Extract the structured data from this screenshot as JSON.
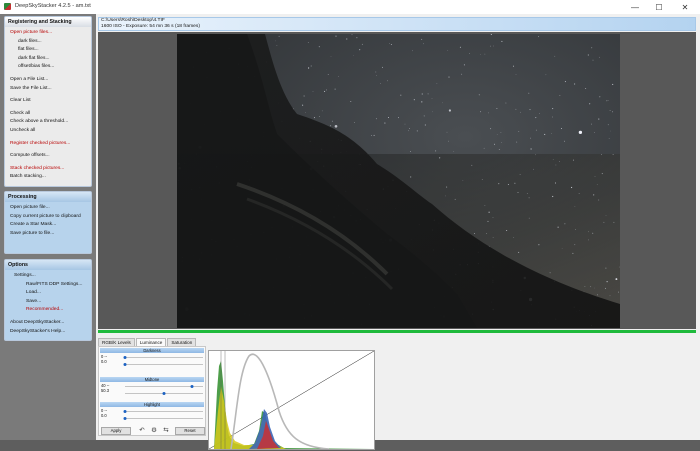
{
  "window": {
    "title": "DeepSkyStacker 4.2.5 - am.txt",
    "minimize_glyph": "—",
    "maximize_glyph": "☐",
    "close_glyph": "✕"
  },
  "panels": {
    "registering": {
      "title": "Registering and Stacking",
      "items": [
        "Open picture files...",
        "dark files...",
        "flat files...",
        "dark flat files...",
        "offset/bias files...",
        "Open a File List...",
        "Save the File List...",
        "Clear List",
        "Check all",
        "Check above a threshold...",
        "Uncheck all",
        "Register checked pictures...",
        "Compute offsets...",
        "Stack checked pictures...",
        "Batch stacking..."
      ]
    },
    "processing": {
      "title": "Processing",
      "items": [
        "Open picture file...",
        "Copy current picture to clipboard",
        "Create a Star Mask...",
        "Save picture to file..."
      ]
    },
    "options": {
      "title": "Options",
      "items": [
        "Settings...",
        "Raw/FITS DDP Settings...",
        "Load...",
        "Save...",
        "Recommended...",
        "About DeepSkyStacker...",
        "DeepSkyStacker's Help..."
      ]
    }
  },
  "info": {
    "path": "C:\\Users\\Rosh\\Desktop\\4.TIF",
    "exposure": "1600 ISO - Exposure: 54 mn 36 s (18 frames)"
  },
  "tabs": [
    "RGB/K Levels",
    "Luminance",
    "Saturation"
  ],
  "active_tab": 1,
  "luminance": {
    "darkness": {
      "label": "Darkness",
      "v1": "0 --",
      "v2": "0.0",
      "level1": 0.0,
      "level2": 0.0
    },
    "midtone": {
      "label": "Midtone",
      "v1": "40 --",
      "v2": "50.3",
      "level1": 0.86,
      "level2": 0.5
    },
    "highlight": {
      "label": "Highlight",
      "v1": "0 --",
      "v2": "0.0",
      "level1": 0.0,
      "level2": 0.0
    },
    "apply_label": "Apply",
    "reset_label": "Reset",
    "undo_icon": "undo-icon",
    "settings_icon": "settings-icon",
    "sync_icon": "sync-icon"
  },
  "colors": {
    "accent_green": "#1fba3c",
    "menu_red": "#b80000",
    "panel_blue": "#b7d3ec"
  }
}
